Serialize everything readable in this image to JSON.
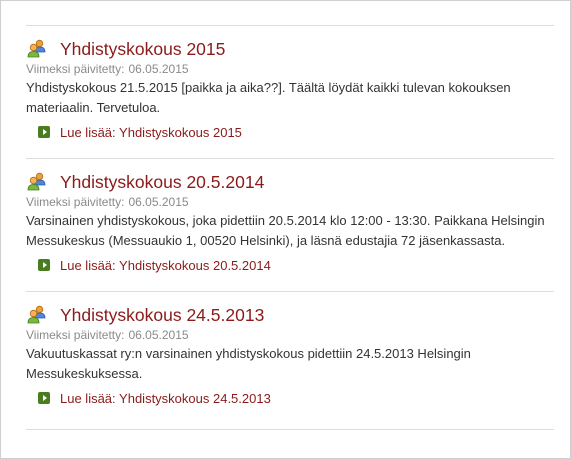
{
  "items": [
    {
      "title": "Yhdistyskokous 2015",
      "updated_label": "Viimeksi päivitetty:",
      "updated_date": "06.05.2015",
      "body": "Yhdistyskokous 21.5.2015 [paikka ja aika??]. Täältä löydät kaikki tulevan kokouksen materiaalin. Tervetuloa.",
      "read_more_prefix": "Lue lisää:",
      "read_more_title": "Yhdistyskokous 2015"
    },
    {
      "title": "Yhdistyskokous 20.5.2014",
      "updated_label": "Viimeksi päivitetty:",
      "updated_date": "06.05.2015",
      "body": "Varsinainen yhdistyskokous, joka pidettiin 20.5.2014 klo 12:00 - 13:30. Paikkana Helsingin Messukeskus (Messuaukio 1, 00520 Helsinki), ja läsnä edustajia 72 jäsenkassasta.",
      "read_more_prefix": "Lue lisää:",
      "read_more_title": "Yhdistyskokous 20.5.2014"
    },
    {
      "title": "Yhdistyskokous 24.5.2013",
      "updated_label": "Viimeksi päivitetty:",
      "updated_date": "06.05.2015",
      "body": "Vakuutuskassat ry:n varsinainen yhdistyskokous pidettiin 24.5.2013 Helsingin Messukeskuksessa.",
      "read_more_prefix": "Lue lisää:",
      "read_more_title": "Yhdistyskokous 24.5.2013"
    }
  ],
  "icons": {
    "title_icon": "users-group-icon",
    "read_more_icon": "arrow-right-icon"
  },
  "colors": {
    "title": "#8b1a1a",
    "link": "#8b1a1a",
    "updated": "#8a8a8a",
    "body": "#333333",
    "arrow": "#4a7d1f"
  }
}
